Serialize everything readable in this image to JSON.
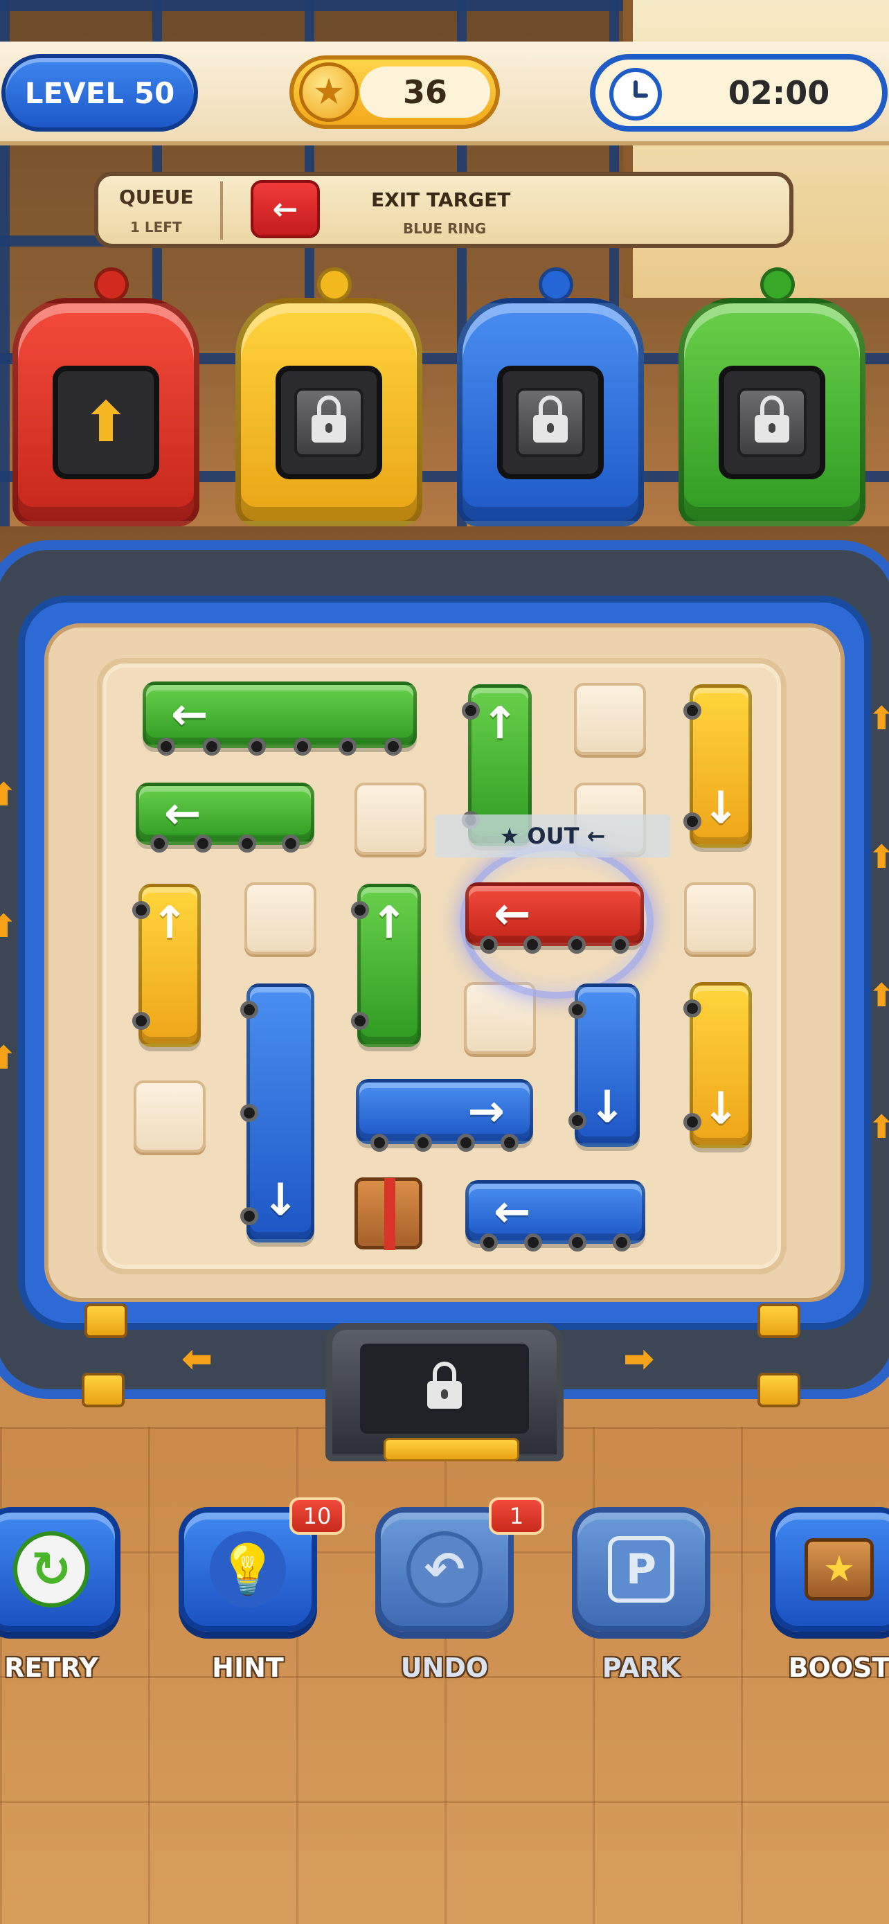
{
  "header": {
    "level": "LEVEL 50",
    "coins": "36",
    "timer": "02:00"
  },
  "queue": {
    "title": "QUEUE",
    "remaining": "1 LEFT",
    "next_car_color": "red",
    "exit_title": "EXIT TARGET",
    "exit_sub": "BLUE RING"
  },
  "garages": [
    {
      "color": "red",
      "state": "open"
    },
    {
      "color": "yellow",
      "state": "locked"
    },
    {
      "color": "blue",
      "state": "locked"
    },
    {
      "color": "green",
      "state": "locked"
    }
  ],
  "board": {
    "out_label": "★ OUT ←",
    "vehicles": [
      {
        "color": "green",
        "direction": "left",
        "length": 3
      },
      {
        "color": "green",
        "direction": "left",
        "length": 2
      },
      {
        "color": "green",
        "direction": "up",
        "length": 2
      },
      {
        "color": "green",
        "direction": "up",
        "length": 2
      },
      {
        "color": "yellow",
        "direction": "down",
        "length": 2
      },
      {
        "color": "yellow",
        "direction": "up",
        "length": 2
      },
      {
        "color": "yellow",
        "direction": "down",
        "length": 2
      },
      {
        "color": "red",
        "direction": "left",
        "length": 2,
        "target": true
      },
      {
        "color": "blue",
        "direction": "down",
        "length": 3
      },
      {
        "color": "blue",
        "direction": "right",
        "length": 2
      },
      {
        "color": "blue",
        "direction": "down",
        "length": 2
      },
      {
        "color": "blue",
        "direction": "left",
        "length": 2
      }
    ]
  },
  "buttons": [
    {
      "label": "RETRY",
      "icon": "retry-icon"
    },
    {
      "label": "HINT",
      "icon": "lightbulb-icon",
      "badge": "10"
    },
    {
      "label": "UNDO",
      "icon": "undo-icon",
      "badge": "1"
    },
    {
      "label": "PARK",
      "icon": "parking-icon"
    },
    {
      "label": "BOOST",
      "icon": "boost-crate-icon"
    }
  ],
  "colors": {
    "red": "#d9301f",
    "yellow": "#f2b81e",
    "blue": "#2566d6",
    "green": "#38a828"
  }
}
